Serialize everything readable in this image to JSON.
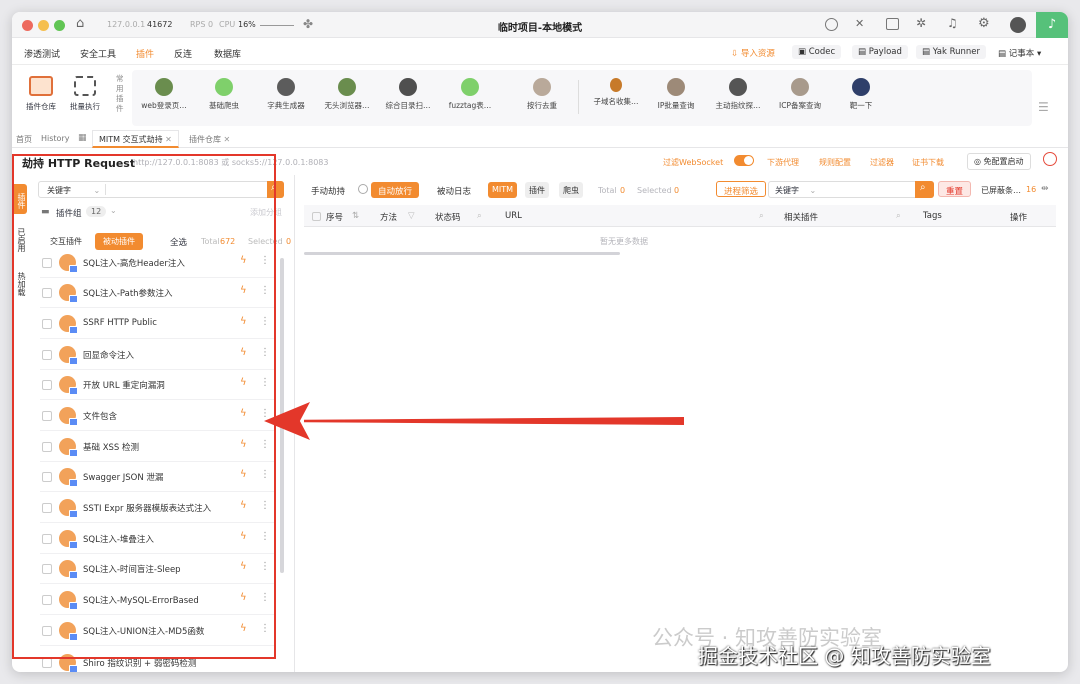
{
  "titlebar": {
    "host": "127.0.0.1",
    "port": "41672",
    "rps": "RPS 0",
    "cpu_label": "CPU",
    "cpu_value": "16%",
    "title": "临时项目-本地模式"
  },
  "menubar": {
    "items": [
      "渗透测试",
      "安全工具",
      "插件",
      "反连",
      "数据库"
    ],
    "right": [
      "导入资源",
      "Codec",
      "Payload",
      "Yak Runner",
      "记事本"
    ]
  },
  "toolbar": {
    "store_label": "插件仓库",
    "batch_label": "批量执行",
    "common_label": "常用插件",
    "plugins": [
      "web登录页…",
      "基础爬虫",
      "字典生成器",
      "无头浏览器…",
      "综合目录扫…",
      "fuzztag表…",
      "按行去重",
      "子域名收集…",
      "IP批量查询",
      "主动指纹探…",
      "ICP备案查询",
      "靶一下"
    ]
  },
  "tabs": {
    "home": "首页",
    "history": "History",
    "mitm": "MITM 交互式劫持",
    "store": "插件仓库"
  },
  "header": {
    "title": "劫持 HTTP Request",
    "addr": "http://127.0.0.1:8083 或 socks5://127.0.0.1:8083",
    "filter_ws": "过滤WebSocket",
    "downstream": "下游代理",
    "rule_cfg": "规则配置",
    "filter": "过滤器",
    "cert_download": "证书下载",
    "free_config": "免配置启动"
  },
  "sidebar": {
    "tabs": [
      "插件",
      "已启用",
      "热加载"
    ]
  },
  "left_panel": {
    "keyword": "关键字",
    "plugin_group": "插件组",
    "group_count": "12",
    "add_to_group": "添加分组",
    "tab_interactive": "交互插件",
    "tab_passive": "被动插件",
    "select_all": "全选",
    "total_label": "Total",
    "total_value": "672",
    "selected_label": "Selected",
    "selected_value": "0",
    "items": [
      "SQL注入-高危Header注入",
      "SQL注入-Path参数注入",
      "SSRF HTTP Public",
      "回显命令注入",
      "开放 URL 重定向漏洞",
      "文件包含",
      "基础 XSS 检测",
      "Swagger JSON 泄漏",
      "SSTI Expr 服务器模版表达式注入",
      "SQL注入-堆叠注入",
      "SQL注入-时间盲注-Sleep",
      "SQL注入-MySQL-ErrorBased",
      "SQL注入-UNION注入-MD5函数",
      "Shiro 指纹识别 + 弱密码检测"
    ]
  },
  "right_panel": {
    "manual": "手动劫持",
    "auto": "自动放行",
    "passive_log": "被动日志",
    "mitm": "MITM",
    "plugin": "插件",
    "crawler": "爬虫",
    "total_label": "Total",
    "total_value": "0",
    "selected_label": "Selected",
    "selected_value": "0",
    "process_filter": "进程筛选",
    "keyword": "关键字",
    "reset": "重置",
    "blocked_label": "已屏蔽条…",
    "blocked_count": "16",
    "columns": [
      "序号",
      "方法",
      "状态码",
      "URL",
      "相关插件",
      "Tags",
      "操作"
    ],
    "empty": "暂无更多数据"
  },
  "watermark": {
    "line1": "公众号 · 知攻善防实验室",
    "line2": "掘金技术社区 @ 知攻善防实验室"
  }
}
